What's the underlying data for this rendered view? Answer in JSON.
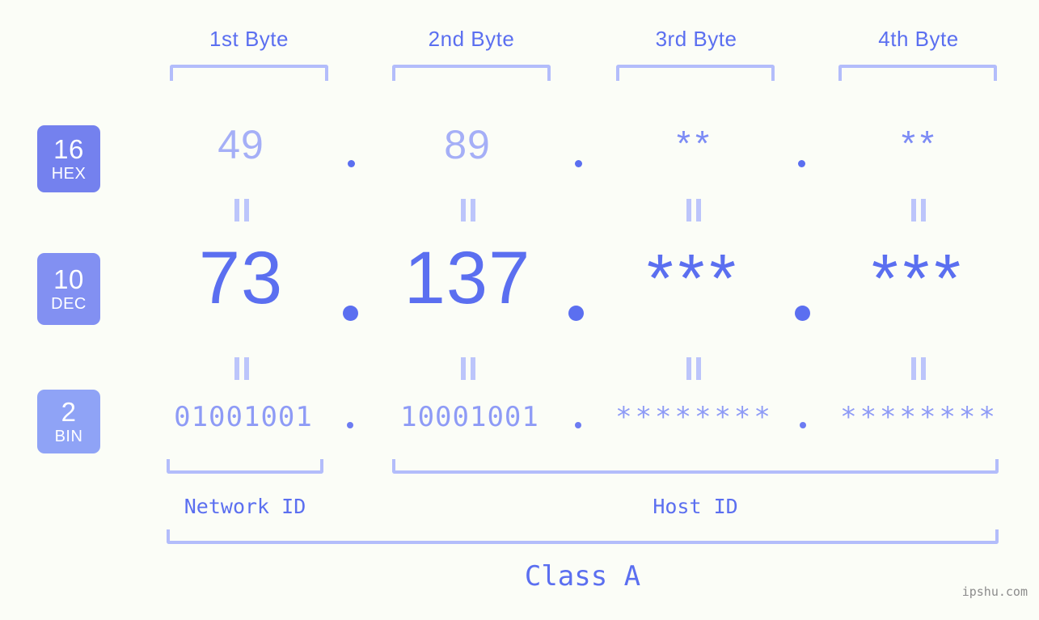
{
  "page": {
    "background": "#fbfdf7",
    "accent": "#5b6ff0",
    "accent_light": "#b3bdfb",
    "watermark": "ipshu.com"
  },
  "columns": [
    {
      "header": "1st Byte"
    },
    {
      "header": "2nd Byte"
    },
    {
      "header": "3rd Byte"
    },
    {
      "header": "4th Byte"
    }
  ],
  "bases": [
    {
      "num": "16",
      "label": "HEX",
      "color": "#7481ee"
    },
    {
      "num": "10",
      "label": "DEC",
      "color": "#8290f2"
    },
    {
      "num": "2",
      "label": "BIN",
      "color": "#8fa3f6"
    }
  ],
  "rows": {
    "hex": {
      "values": [
        "49",
        "89",
        "**",
        "**"
      ]
    },
    "dec": {
      "values": [
        "73",
        "137",
        "***",
        "***"
      ]
    },
    "bin": {
      "values": [
        "01001001",
        "10001001",
        "********",
        "********"
      ]
    }
  },
  "separator": ".",
  "sections": {
    "network_id": "Network ID",
    "host_id": "Host ID",
    "class": "Class A"
  }
}
